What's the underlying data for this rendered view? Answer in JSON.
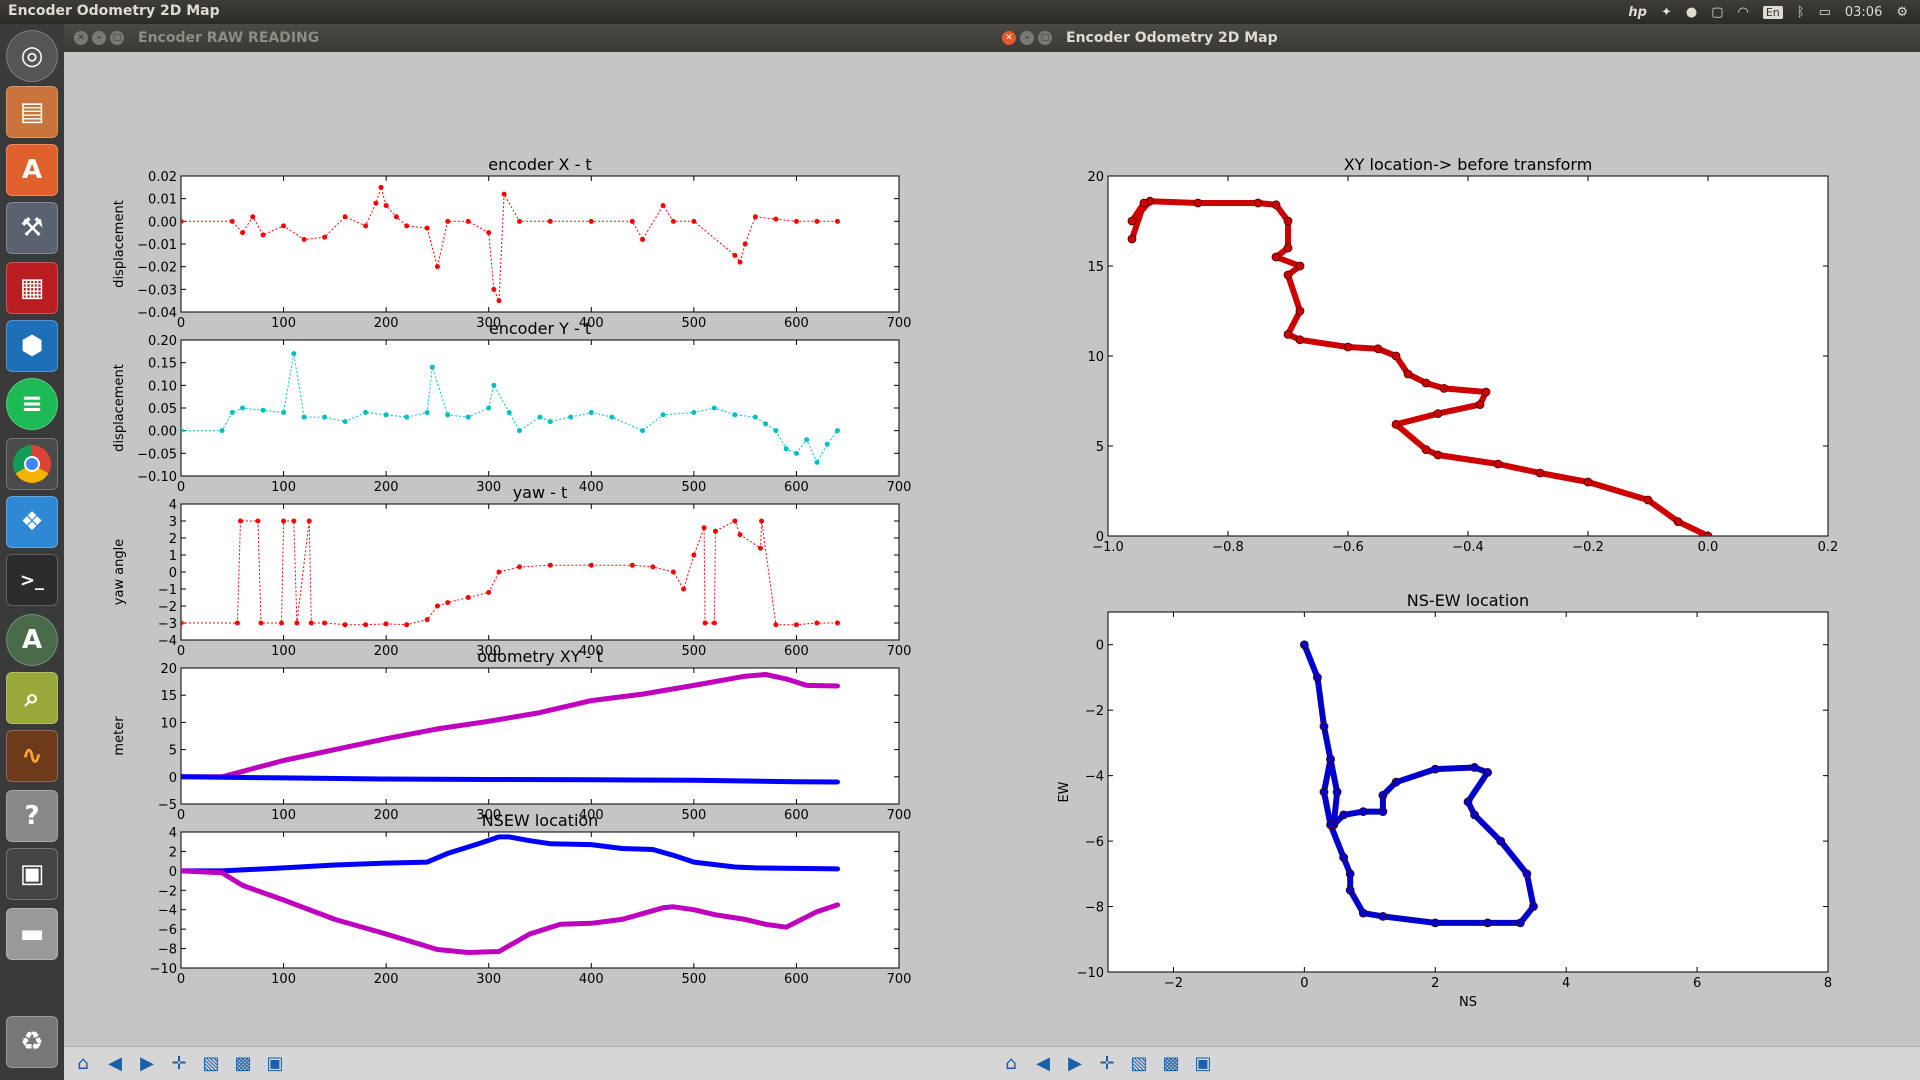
{
  "topbar": {
    "title": "Encoder Odometry 2D Map",
    "clock": "03:06",
    "lang": "En"
  },
  "left_window": {
    "title": "Encoder RAW READING"
  },
  "right_window": {
    "title": "Encoder Odometry 2D Map"
  },
  "launcher": [
    "ubuntu-dash",
    "files",
    "software-center",
    "settings",
    "app-red",
    "vscode",
    "spotify",
    "chrome",
    "dropbox",
    "terminal",
    "software-updater",
    "image-viewer",
    "oscilloscope",
    "help",
    "workspaces",
    "drive"
  ],
  "toolbar": [
    "home",
    "back",
    "forward",
    "pan",
    "zoom",
    "configure-subplots",
    "save"
  ],
  "chart_data": [
    {
      "type": "scatter",
      "title": "encoder X - t",
      "xlabel": "",
      "ylabel": "displacement",
      "xlim": [
        0,
        700
      ],
      "ylim": [
        -0.04,
        0.02
      ],
      "xticks": [
        "0",
        "100",
        "200",
        "300",
        "400",
        "500",
        "600",
        "700"
      ],
      "yticks": [
        "0.02",
        "0.01",
        "0.00",
        "−0.01",
        "−0.02",
        "−0.03",
        "−0.04"
      ],
      "color": "#ff0000",
      "series": [
        {
          "x": [
            0,
            50,
            60,
            70,
            80,
            100,
            120,
            140,
            160,
            180,
            190,
            195,
            200,
            210,
            220,
            240,
            250,
            260,
            280,
            300,
            305,
            310,
            315,
            330,
            360,
            400,
            440,
            450,
            470,
            480,
            500,
            540,
            545,
            550,
            560,
            580,
            600,
            620,
            640
          ],
          "y": [
            0,
            0,
            -0.005,
            0.002,
            -0.006,
            -0.002,
            -0.008,
            -0.007,
            0.002,
            -0.002,
            0.008,
            0.015,
            0.007,
            0.002,
            -0.002,
            -0.003,
            -0.02,
            0,
            0,
            -0.005,
            -0.03,
            -0.035,
            0.012,
            0,
            0,
            0,
            0,
            -0.008,
            0.007,
            0,
            0,
            -0.015,
            -0.018,
            -0.01,
            0.002,
            0.001,
            0,
            0,
            0
          ]
        }
      ]
    },
    {
      "type": "scatter",
      "title": "encoder Y - t",
      "xlabel": "",
      "ylabel": "displacement",
      "xlim": [
        0,
        700
      ],
      "ylim": [
        -0.1,
        0.2
      ],
      "xticks": [
        "0",
        "100",
        "200",
        "300",
        "400",
        "500",
        "600",
        "700"
      ],
      "yticks": [
        "0.20",
        "0.15",
        "0.10",
        "0.05",
        "0.00",
        "−0.05",
        "−0.10"
      ],
      "color": "#00bfbf",
      "series": [
        {
          "x": [
            0,
            40,
            50,
            60,
            80,
            100,
            110,
            120,
            140,
            160,
            180,
            200,
            220,
            240,
            245,
            260,
            280,
            300,
            305,
            320,
            330,
            350,
            360,
            380,
            400,
            420,
            450,
            470,
            500,
            520,
            540,
            560,
            570,
            580,
            590,
            600,
            610,
            620,
            630,
            640
          ],
          "y": [
            0,
            0,
            0.04,
            0.05,
            0.045,
            0.04,
            0.17,
            0.03,
            0.03,
            0.02,
            0.04,
            0.035,
            0.03,
            0.04,
            0.14,
            0.035,
            0.03,
            0.05,
            0.1,
            0.04,
            0,
            0.03,
            0.02,
            0.03,
            0.04,
            0.03,
            0,
            0.035,
            0.04,
            0.05,
            0.035,
            0.03,
            0.015,
            0,
            -0.04,
            -0.05,
            -0.02,
            -0.07,
            -0.03,
            0
          ]
        }
      ]
    },
    {
      "type": "scatter",
      "title": "yaw - t",
      "xlabel": "",
      "ylabel": "yaw angle",
      "xlim": [
        0,
        700
      ],
      "ylim": [
        -4,
        4
      ],
      "xticks": [
        "0",
        "100",
        "200",
        "300",
        "400",
        "500",
        "600",
        "700"
      ],
      "yticks": [
        "4",
        "3",
        "2",
        "1",
        "0",
        "−1",
        "−2",
        "−3",
        "−4"
      ],
      "color": "#ff0000",
      "series": [
        {
          "x": [
            0,
            55,
            58,
            75,
            78,
            98,
            100,
            110,
            113,
            125,
            127,
            140,
            160,
            180,
            200,
            220,
            240,
            250,
            260,
            280,
            300,
            310,
            330,
            360,
            400,
            440,
            460,
            480,
            490,
            500,
            510,
            511,
            520,
            521,
            540,
            545,
            565,
            566,
            580,
            600,
            620,
            640
          ],
          "y": [
            -3,
            -3,
            3,
            3,
            -3,
            -3,
            3,
            3,
            -3,
            3,
            -3,
            -3,
            -3.1,
            -3.1,
            -3.05,
            -3.1,
            -2.8,
            -2,
            -1.8,
            -1.5,
            -1.2,
            0,
            0.3,
            0.4,
            0.4,
            0.4,
            0.3,
            0,
            -1,
            1,
            2.6,
            -3,
            -3,
            2.4,
            3,
            2.2,
            1.4,
            3,
            -3.1,
            -3.1,
            -3,
            -3
          ]
        }
      ]
    },
    {
      "type": "line",
      "title": "odometry XY - t",
      "xlabel": "",
      "ylabel": "meter",
      "xlim": [
        0,
        700
      ],
      "ylim": [
        -5,
        20
      ],
      "xticks": [
        "0",
        "100",
        "200",
        "300",
        "400",
        "500",
        "600",
        "700"
      ],
      "yticks": [
        "20",
        "15",
        "10",
        "5",
        "0",
        "−5"
      ],
      "series": [
        {
          "color": "#bf00bf",
          "x": [
            0,
            40,
            60,
            100,
            150,
            200,
            250,
            300,
            350,
            400,
            450,
            500,
            550,
            570,
            590,
            610,
            640
          ],
          "y": [
            0,
            0,
            1,
            3,
            5,
            7,
            8.8,
            10.2,
            11.8,
            14,
            15.2,
            16.8,
            18.5,
            18.8,
            18,
            16.8,
            16.7
          ]
        },
        {
          "color": "#0000ff",
          "x": [
            0,
            100,
            200,
            300,
            400,
            500,
            600,
            640
          ],
          "y": [
            0,
            -0.2,
            -0.4,
            -0.5,
            -0.55,
            -0.65,
            -0.9,
            -0.95
          ]
        }
      ]
    },
    {
      "type": "line",
      "title": "NSEW location",
      "xlabel": "",
      "ylabel": "",
      "xlim": [
        0,
        700
      ],
      "ylim": [
        -10,
        4
      ],
      "xticks": [
        "0",
        "100",
        "200",
        "300",
        "400",
        "500",
        "600",
        "700"
      ],
      "yticks": [
        "4",
        "2",
        "0",
        "−2",
        "−4",
        "−6",
        "−8",
        "−10"
      ],
      "series": [
        {
          "color": "#0000ff",
          "x": [
            0,
            40,
            60,
            100,
            150,
            200,
            240,
            260,
            290,
            310,
            320,
            340,
            360,
            400,
            430,
            460,
            480,
            500,
            540,
            560,
            600,
            640
          ],
          "y": [
            0,
            0,
            0.1,
            0.3,
            0.6,
            0.8,
            0.9,
            1.8,
            2.8,
            3.5,
            3.5,
            3.1,
            2.8,
            2.7,
            2.3,
            2.2,
            1.6,
            0.9,
            0.4,
            0.3,
            0.25,
            0.2
          ]
        },
        {
          "color": "#bf00bf",
          "x": [
            0,
            40,
            60,
            100,
            150,
            200,
            250,
            280,
            310,
            340,
            370,
            400,
            430,
            470,
            480,
            500,
            520,
            550,
            570,
            590,
            620,
            640
          ],
          "y": [
            0,
            -0.2,
            -1.5,
            -3,
            -5,
            -6.5,
            -8.1,
            -8.4,
            -8.3,
            -6.5,
            -5.5,
            -5.4,
            -5,
            -3.8,
            -3.7,
            -4,
            -4.5,
            -5,
            -5.5,
            -5.8,
            -4.2,
            -3.5
          ]
        }
      ]
    },
    {
      "type": "scatter",
      "title": "XY location-> before transform",
      "xlabel": "",
      "ylabel": "",
      "xlim": [
        -1.0,
        0.2
      ],
      "ylim": [
        0,
        20
      ],
      "xticks": [
        "−1.0",
        "−0.8",
        "−0.6",
        "−0.4",
        "−0.2",
        "0.0",
        "0.2"
      ],
      "yticks": [
        "20",
        "15",
        "10",
        "5",
        "0"
      ],
      "color": "#cc0000",
      "series": [
        {
          "x": [
            0,
            -0.05,
            -0.1,
            -0.2,
            -0.28,
            -0.35,
            -0.45,
            -0.47,
            -0.52,
            -0.45,
            -0.38,
            -0.37,
            -0.44,
            -0.47,
            -0.5,
            -0.52,
            -0.55,
            -0.6,
            -0.68,
            -0.7,
            -0.68,
            -0.7,
            -0.68,
            -0.72,
            -0.7,
            -0.7,
            -0.72,
            -0.75,
            -0.85,
            -0.93,
            -0.96,
            -0.94,
            -0.96
          ],
          "y": [
            0,
            0.8,
            2,
            3,
            3.5,
            4,
            4.5,
            4.8,
            6.2,
            6.8,
            7.3,
            8,
            8.2,
            8.5,
            9,
            10,
            10.4,
            10.5,
            10.9,
            11.2,
            12.5,
            14.5,
            15,
            15.5,
            16,
            17.5,
            18.4,
            18.5,
            18.5,
            18.6,
            17.5,
            18.5,
            16.5
          ]
        }
      ]
    },
    {
      "type": "scatter",
      "title": "NS-EW location",
      "xlabel": "NS",
      "ylabel": "EW",
      "xlim": [
        -3,
        8
      ],
      "ylim": [
        -10,
        1
      ],
      "xticks": [
        "−2",
        "0",
        "2",
        "4",
        "6",
        "8"
      ],
      "yticks": [
        "0",
        "−2",
        "−4",
        "−6",
        "−8",
        "−10"
      ],
      "color": "#0000cc",
      "series": [
        {
          "x": [
            0,
            0.2,
            0.3,
            0.4,
            0.5,
            0.45,
            0.6,
            0.9,
            1.2,
            1.2,
            1.4,
            2,
            2.6,
            2.8,
            2.5,
            2.6,
            3,
            3.4,
            3.5,
            3.3,
            2.8,
            2,
            1.2,
            0.9,
            0.7,
            0.7,
            0.6,
            0.4,
            0.3,
            0.4
          ],
          "y": [
            0,
            -1,
            -2.5,
            -3.5,
            -4.5,
            -5.5,
            -5.2,
            -5.1,
            -5.1,
            -4.6,
            -4.2,
            -3.8,
            -3.75,
            -3.9,
            -4.8,
            -5.2,
            -6,
            -7,
            -8,
            -8.5,
            -8.5,
            -8.5,
            -8.3,
            -8.2,
            -7.5,
            -7,
            -6.5,
            -5.5,
            -4.5,
            -3.5
          ]
        }
      ]
    }
  ]
}
